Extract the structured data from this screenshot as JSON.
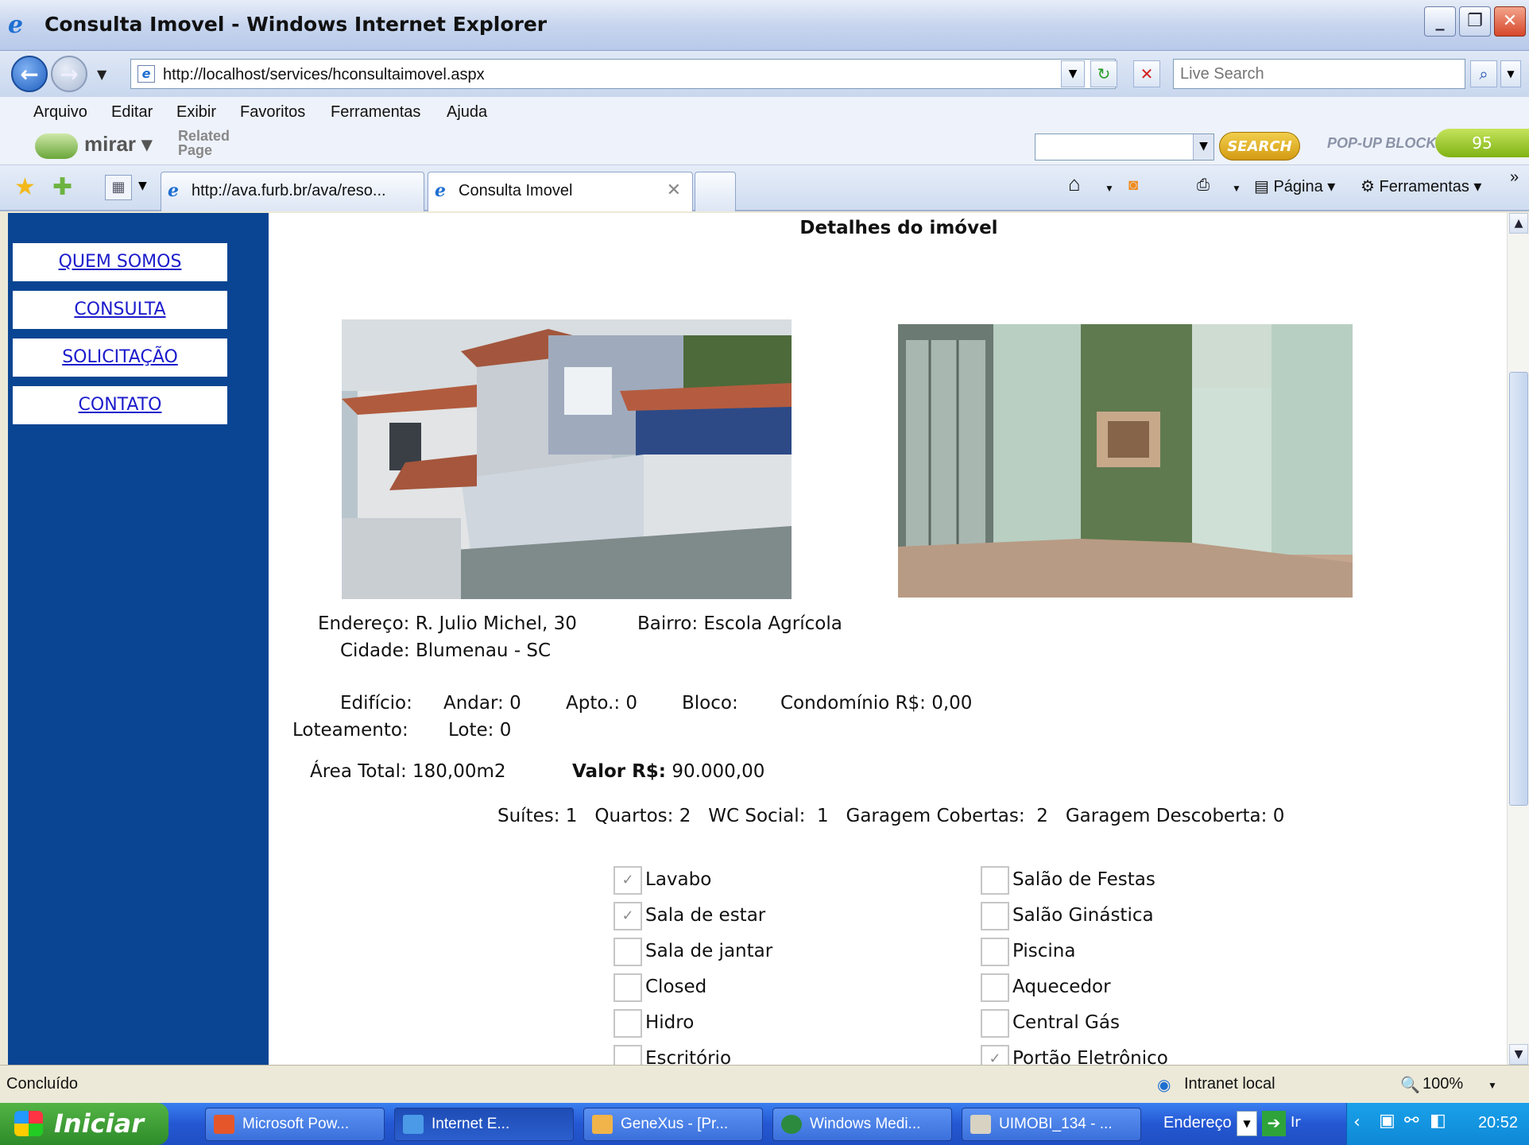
{
  "window": {
    "title": "Consulta Imovel - Windows Internet Explorer",
    "min": "_",
    "max": "❐",
    "close": "✕"
  },
  "address": {
    "url": "http://localhost/services/hconsultaimovel.aspx",
    "search_placeholder": "Live Search"
  },
  "menu": [
    "Arquivo",
    "Editar",
    "Exibir",
    "Favoritos",
    "Ferramentas",
    "Ajuda"
  ],
  "toolbar": {
    "mirar": "mirar",
    "related": "Related",
    "page": "Page",
    "search_btn": "SEARCH",
    "popup_blocker": "POP-UP BLOCKER",
    "counter": "95"
  },
  "tabs": [
    {
      "label": "http://ava.furb.br/ava/reso..."
    },
    {
      "label": "Consulta Imovel"
    }
  ],
  "commands": {
    "page": "Página",
    "tools": "Ferramentas"
  },
  "sidebar": {
    "items": [
      {
        "label": "QUEM SOMOS"
      },
      {
        "label": "CONSULTA"
      },
      {
        "label": "SOLICITAÇÃO"
      },
      {
        "label": "CONTATO"
      }
    ]
  },
  "property": {
    "heading": "Detalhes do imóvel",
    "endereco": "Endereço: R. Julio Michel, 30",
    "bairro": "Bairro: Escola Agrícola",
    "cidade": "Cidade: Blumenau - SC",
    "edificio": "Edifício:",
    "andar": "Andar: 0",
    "apto": "Apto.: 0",
    "bloco": "Bloco:",
    "condominio": "Condomínio  R$: 0,00",
    "loteamento": "Loteamento:",
    "lote": "Lote: 0",
    "area": "Área Total: 180,00m2",
    "valor_label": "Valor R$:",
    "valor": "90.000,00",
    "rooms": "Suítes: 1   Quartos: 2   WC Social:  1   Garagem Cobertas:  2   Garagem Descoberta: 0"
  },
  "amenities_left": [
    {
      "label": "Lavabo",
      "checked": true
    },
    {
      "label": "Sala de estar",
      "checked": true
    },
    {
      "label": "Sala de jantar",
      "checked": false
    },
    {
      "label": "Closed",
      "checked": false
    },
    {
      "label": "Hidro",
      "checked": false
    },
    {
      "label": "Escritório",
      "checked": false
    }
  ],
  "amenities_right": [
    {
      "label": "Salão de Festas",
      "checked": false
    },
    {
      "label": "Salão Ginástica",
      "checked": false
    },
    {
      "label": "Piscina",
      "checked": false
    },
    {
      "label": "Aquecedor",
      "checked": false
    },
    {
      "label": "Central Gás",
      "checked": false
    },
    {
      "label": "Portão Eletrônico",
      "checked": true
    }
  ],
  "status": {
    "text": "Concluído",
    "zone": "Intranet local",
    "zoom": "100%"
  },
  "taskbar": {
    "start": "Iniciar",
    "tasks": [
      "Microsoft Pow...",
      "Internet E...",
      "GeneXus - [Pr...",
      "Windows Medi...",
      "UIMOBI_134 - ..."
    ],
    "address_label": "Endereço",
    "go": "Ir",
    "clock": "20:52"
  }
}
